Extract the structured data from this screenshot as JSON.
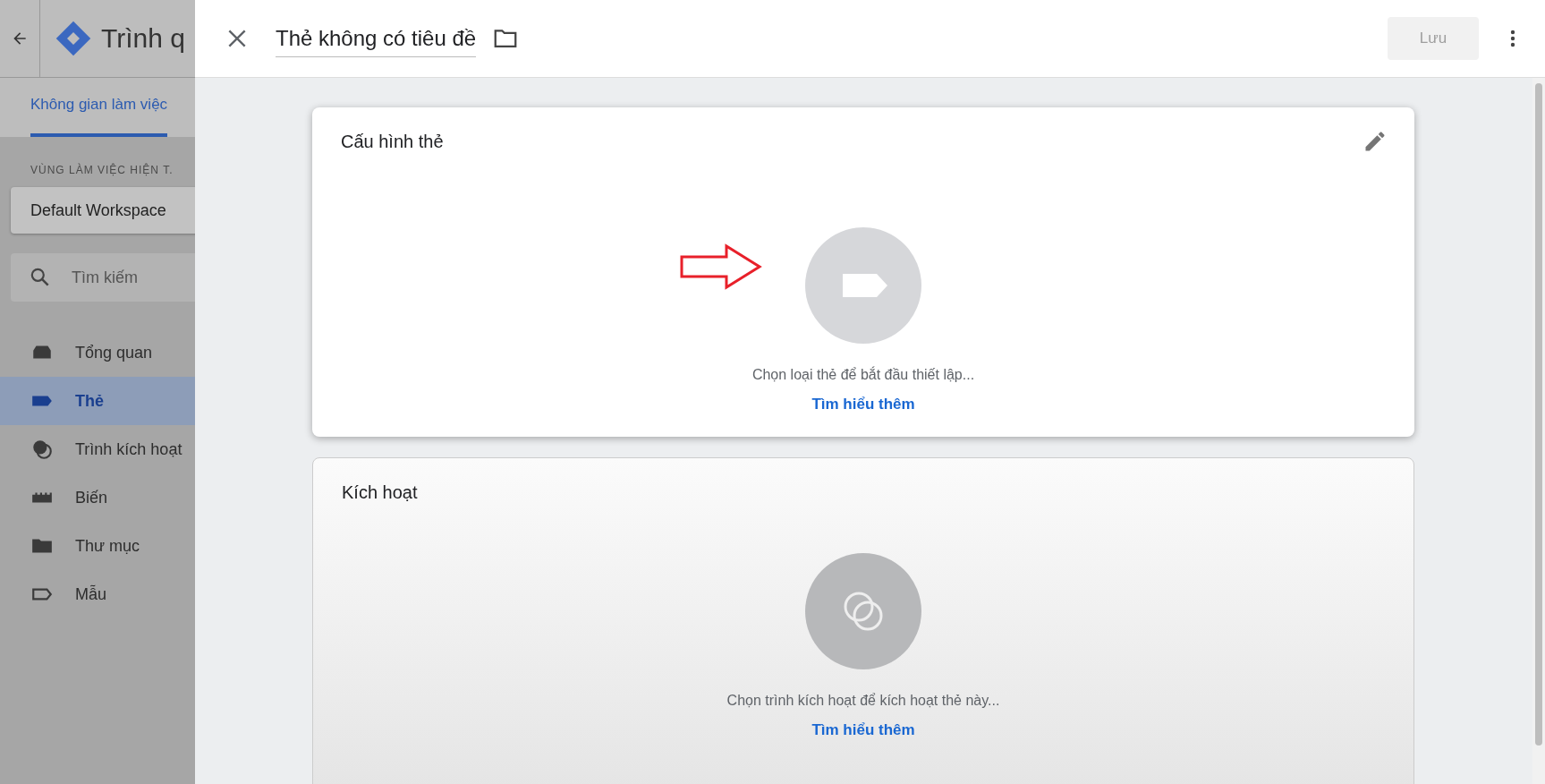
{
  "app_header": {
    "title": "Trình q"
  },
  "workspace_tab": {
    "label": "Không gian làm việc",
    "selected": true
  },
  "sidebar": {
    "section_label": "VÙNG LÀM VIỆC HIỆN T.",
    "workspace": "Default Workspace",
    "search": {
      "placeholder": "Tìm kiếm"
    },
    "items": [
      {
        "label": "Tổng quan",
        "kind": "overview",
        "selected": false
      },
      {
        "label": "Thẻ",
        "kind": "tag",
        "selected": true
      },
      {
        "label": "Trình kích hoạt",
        "kind": "trigger",
        "selected": false
      },
      {
        "label": "Biến",
        "kind": "variable",
        "selected": false
      },
      {
        "label": "Thư mục",
        "kind": "folder",
        "selected": false
      },
      {
        "label": "Mẫu",
        "kind": "template",
        "selected": false
      }
    ]
  },
  "panel": {
    "title": "Thẻ không có tiêu đề",
    "save_button": {
      "label": "Lưu",
      "disabled": true
    }
  },
  "cards": [
    {
      "kind": "tag",
      "title": "Cấu hình thẻ",
      "hint": "Chọn loại thẻ để bắt đầu thiết lập...",
      "link": "Tìm hiểu thêm"
    },
    {
      "kind": "trigger",
      "title": "Kích hoạt",
      "hint": "Chọn trình kích hoạt để kích hoạt thẻ này...",
      "link": "Tìm hiểu thêm"
    }
  ]
}
